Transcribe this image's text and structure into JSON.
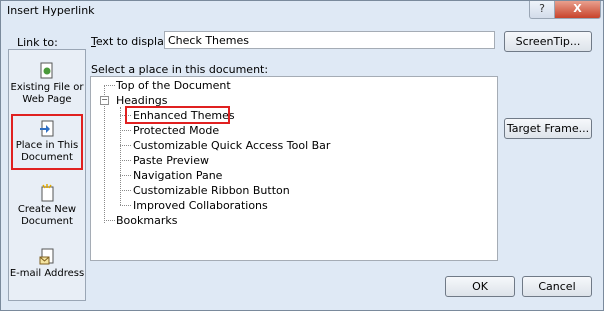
{
  "window": {
    "title": "Insert Hyperlink",
    "help_button": "?",
    "close_button": "X"
  },
  "link_to": {
    "label": "Link to:",
    "items": [
      {
        "label_line1": "Existing File or",
        "label_line2": "Web Page",
        "icon": "existing-file-icon"
      },
      {
        "label_line1": "Place in This",
        "label_line2": "Document",
        "icon": "place-in-document-icon",
        "selected": true
      },
      {
        "label_line1": "Create New",
        "label_line2": "Document",
        "icon": "create-new-document-icon"
      },
      {
        "label_line1": "E-mail Address",
        "label_line2": "",
        "icon": "email-address-icon"
      }
    ]
  },
  "display": {
    "label_underline": "T",
    "label_rest": "ext to display:",
    "value": "Check Themes"
  },
  "buttons": {
    "screentip": "ScreenTip...",
    "target_frame": "Target Frame...",
    "ok": "OK",
    "cancel": "Cancel"
  },
  "tree": {
    "label": "Select a place in this document:",
    "top": "Top of the Document",
    "headings": "Headings",
    "expander": "−",
    "items": [
      "Enhanced Themes",
      "Protected Mode",
      "Customizable Quick Access Tool Bar",
      "Paste Preview",
      "Navigation Pane",
      "Customizable Ribbon Button",
      "Improved Collaborations"
    ],
    "selected_index": 0,
    "bookmarks": "Bookmarks"
  },
  "colors": {
    "highlight": "#e02020",
    "dialog_bg": "#dfe9f5"
  }
}
